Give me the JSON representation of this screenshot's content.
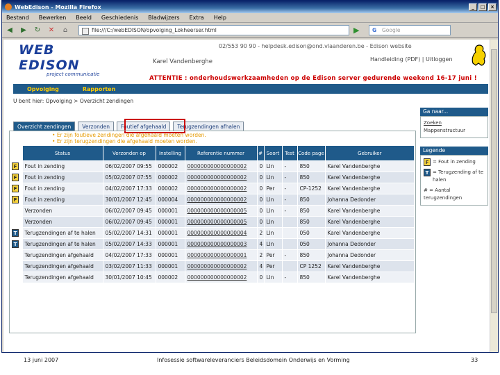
{
  "window": {
    "title": "WebEdison - Mozilla Firefox"
  },
  "menu": [
    "Bestand",
    "Bewerken",
    "Beeld",
    "Geschiedenis",
    "Bladwijzers",
    "Extra",
    "Help"
  ],
  "address": {
    "url": "file:///C:/webEDISON/opvolging_Lokheerser.html",
    "search_placeholder": "Google"
  },
  "header": {
    "logo_text": "WEB EDISON",
    "logo_sub": "project communicatie",
    "contact": "02/553 90 90 - helpdesk.edison@ond.vlaanderen.be - Edison website",
    "user": "Karel Vandenberghe",
    "manual": "Handleiding (PDF) | Uitloggen",
    "warning": "ATTENTIE : onderhoudswerkzaamheden op de Edison server gedurende weekend 16-17 juni !"
  },
  "nav": {
    "items": [
      "Opvolging",
      "Rapporten"
    ]
  },
  "breadcrumb": "U bent hier: Opvolging > Overzicht zendingen",
  "tabs": [
    "Overzicht zendingen",
    "Verzonden",
    "Foutief afgehaald",
    "Terugzendingen afhalen"
  ],
  "messages": [
    "Er zijn foutieve zendingen die afgehaald moeten worden.",
    "Er zijn terugzendingen die afgehaald moeten worden."
  ],
  "table": {
    "headers": [
      "Status",
      "Verzonden op",
      "Instelling",
      "Referentie nummer",
      "#",
      "Soort",
      "Test",
      "Code page",
      "Gebruiker"
    ],
    "rows": [
      {
        "icon": "F",
        "status": "Fout in zending",
        "date": "06/02/2007 09:55",
        "inst": "000002",
        "ref": "000000000000000002",
        "n": "0",
        "soort": "Lln",
        "test": "-",
        "cp": "850",
        "user": "Karel Vandenberghe"
      },
      {
        "icon": "F",
        "status": "Fout in zending",
        "date": "05/02/2007 07:55",
        "inst": "000002",
        "ref": "000000000000000002",
        "n": "0",
        "soort": "Lln",
        "test": "-",
        "cp": "850",
        "user": "Karel Vandenberghe"
      },
      {
        "icon": "F",
        "status": "Fout in zending",
        "date": "04/02/2007 17:33",
        "inst": "000002",
        "ref": "000000000000000002",
        "n": "0",
        "soort": "Per",
        "test": "-",
        "cp": "CP-1252",
        "user": "Karel Vandenberghe"
      },
      {
        "icon": "F",
        "status": "Fout in zending",
        "date": "30/01/2007 12:45",
        "inst": "000004",
        "ref": "000000000000000002",
        "n": "0",
        "soort": "Lln",
        "test": "-",
        "cp": "850",
        "user": "Johanna Dedonder"
      },
      {
        "icon": "",
        "status": "Verzonden",
        "date": "06/02/2007 09:45",
        "inst": "000001",
        "ref": "000000000000000005",
        "n": "0",
        "soort": "Lln",
        "test": "-",
        "cp": "850",
        "user": "Karel Vandenberghe"
      },
      {
        "icon": "",
        "status": "Verzonden",
        "date": "06/02/2007 09:45",
        "inst": "000001",
        "ref": "000000000000000005",
        "n": "0",
        "soort": "Lln",
        "test": "",
        "cp": "850",
        "user": "Karel Vandenberghe"
      },
      {
        "icon": "T",
        "status": "Terugzendingen af te halen",
        "date": "05/02/2007 14:31",
        "inst": "000001",
        "ref": "000000000000000004",
        "n": "2",
        "soort": "Lln",
        "test": "",
        "cp": "050",
        "user": "Karel Vandenberghe"
      },
      {
        "icon": "T",
        "status": "Terugzendingen af te halen",
        "date": "05/02/2007 14:33",
        "inst": "000001",
        "ref": "000000000000000003",
        "n": "4",
        "soort": "Lln",
        "test": "",
        "cp": "050",
        "user": "Johanna Dedonder"
      },
      {
        "icon": "",
        "status": "Terugzendingen afgehaald",
        "date": "04/02/2007 17:33",
        "inst": "000001",
        "ref": "000000000000000001",
        "n": "2",
        "soort": "Per",
        "test": "-",
        "cp": "850",
        "user": "Johanna Dedonder"
      },
      {
        "icon": "",
        "status": "Terugzendingen afgehaald",
        "date": "03/02/2007 11:33",
        "inst": "000001",
        "ref": "000000000000000002",
        "n": "4",
        "soort": "Per",
        "test": "",
        "cp": "CP 1252",
        "user": "Karel Vandenberghe"
      },
      {
        "icon": "",
        "status": "Terugzendingen afgehaald",
        "date": "30/01/2007 10:45",
        "inst": "000002",
        "ref": "000000000000000002",
        "n": "0",
        "soort": "Lln",
        "test": "-",
        "cp": "850",
        "user": "Karel Vandenberghe"
      }
    ]
  },
  "sidebar": {
    "goto_title": "Ga naar...",
    "goto_items": [
      "Zoeken",
      "Mappenstructuur"
    ],
    "legend_title": "Legende",
    "legend_f": "= Fout in zending",
    "legend_t": "= Terugzending af te halen",
    "legend_n": "# = Aantal terugzendingen"
  },
  "footer": {
    "date": "13 juni 2007",
    "center": "Infosessie softwareleveranciers Beleidsdomein Onderwijs en Vorming",
    "page": "33"
  }
}
